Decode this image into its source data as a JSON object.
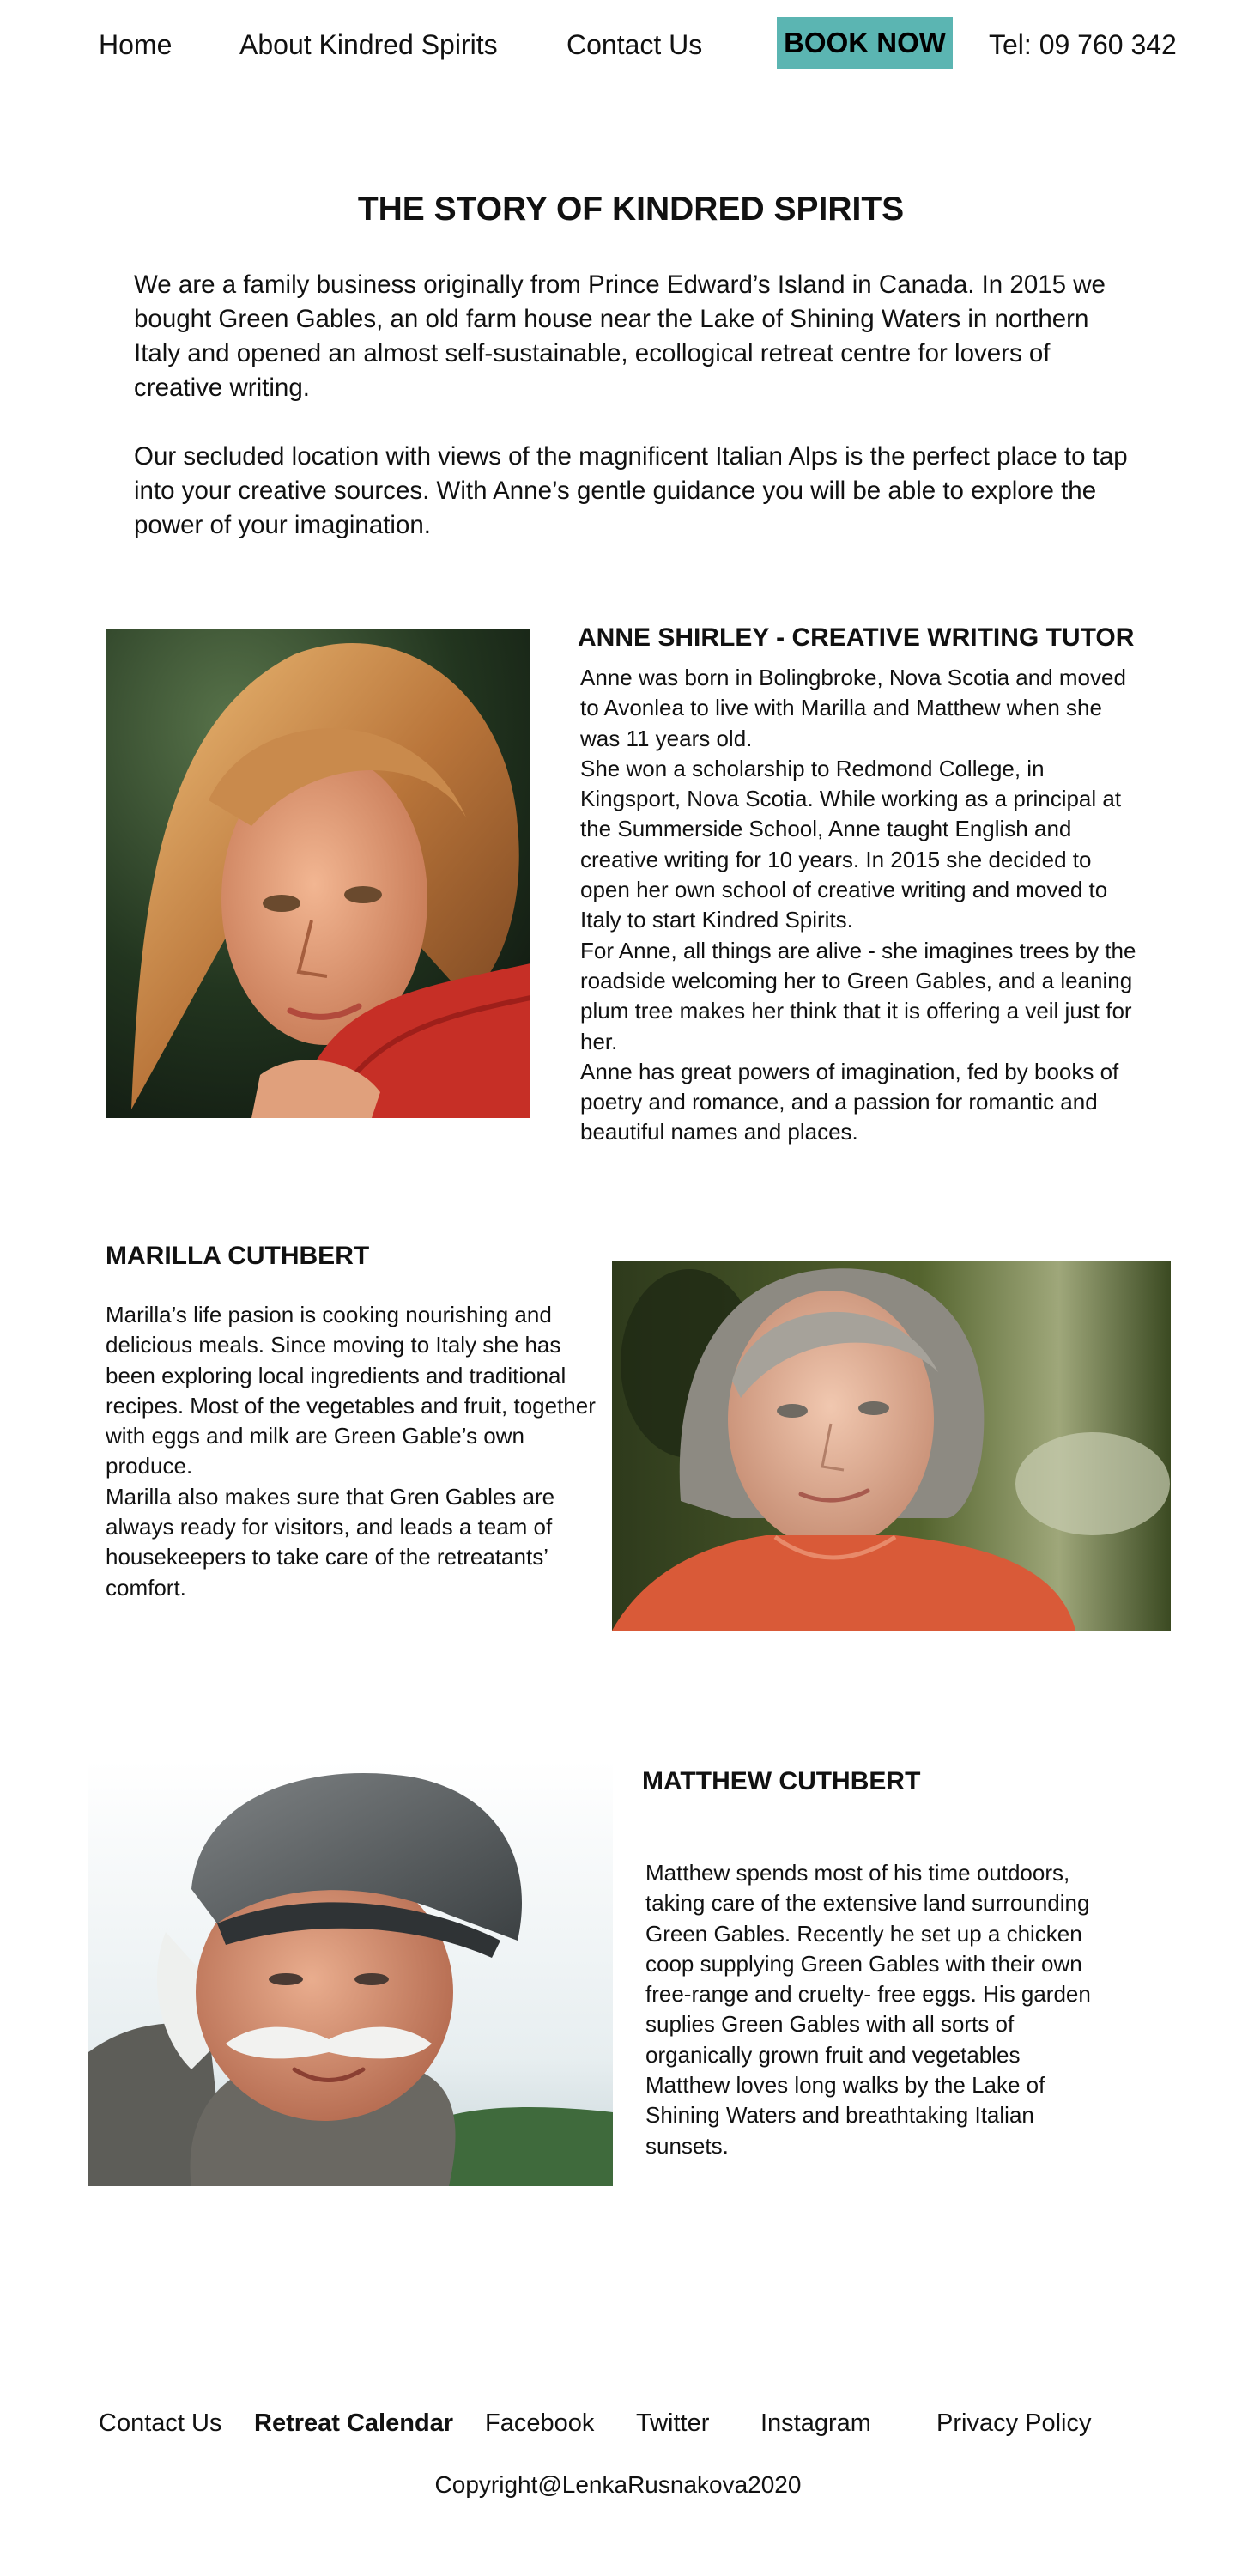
{
  "nav": {
    "home": "Home",
    "about": "About Kindred Spirits",
    "contact": "Contact Us",
    "book_now": "BOOK NOW",
    "tel": "Tel: 09 760 342"
  },
  "story": {
    "title": "THE STORY OF KINDRED SPIRITS",
    "paragraphs": [
      "We are a family business originally from Prince Edward’s Island in Canada. In 2015 we bought Green Gables, an old farm house near the Lake of Shining Waters in northern Italy and opened an almost self-sustainable, ecollogical retreat centre for lovers of creative writing.",
      "Our secluded location with views of the magnificent Italian Alps is the perfect place to tap into your creative sources. With Anne’s gentle guidance you will be able to explore  the power of your imagination."
    ]
  },
  "profiles": [
    {
      "name": "ANNE SHIRLEY  -  CREATIVE WRITING TUTOR",
      "bio": [
        "Anne was born in Bolingbroke, Nova Scotia and moved to Avonlea to live with Marilla and Matthew when she was 11 years old.",
        "She won a scholarship to Redmond College, in Kingsport, Nova Scotia. While working as a principal at the Summerside School, Anne taught English and creative writing for 10 years. In 2015 she decided to open her own school of creative writing and moved to Italy to start Kindred Spirits.",
        "For Anne, all things are alive -  she imagines trees by the roadside welcoming her to Green Gables, and a leaning plum tree makes her think that it is offering a veil just for her.",
        "Anne has great powers of imagination, fed by books of poetry and romance, and a passion for romantic and beautiful names and places."
      ]
    },
    {
      "name": "MARILLA CUTHBERT",
      "bio": [
        "Marilla’s life pasion is cooking nourishing and delicious meals. Since moving to Italy she has been exploring local ingredients and traditional recipes. Most of the vegetables and fruit, together with eggs and milk are Green Gable’s own produce.",
        "Marilla also makes sure that Gren Gables are always ready for visitors, and leads a team of housekeepers to take care of the retreatants’ comfort."
      ]
    },
    {
      "name": "MATTHEW CUTHBERT",
      "bio": [
        "Matthew spends most of his time outdoors, taking care of the extensive land surrounding Green Gables. Recently he set up a chicken coop supplying Green Gables with their own free-range and cruelty- free eggs.  His garden suplies Green Gables with all sorts of organically grown fruit and vegetables",
        "Matthew loves long walks by the Lake of Shining Waters and breathtaking Italian sunsets."
      ]
    }
  ],
  "footer": {
    "links": [
      "Contact Us",
      "Retreat Calendar",
      "Facebook",
      "Twitter",
      "Instagram",
      "Privacy Policy"
    ],
    "copyright": "Copyright@LenkaRusnakova2020"
  },
  "colors": {
    "accent": "#5bb5b2",
    "text": "#111111",
    "background": "#ffffff"
  }
}
